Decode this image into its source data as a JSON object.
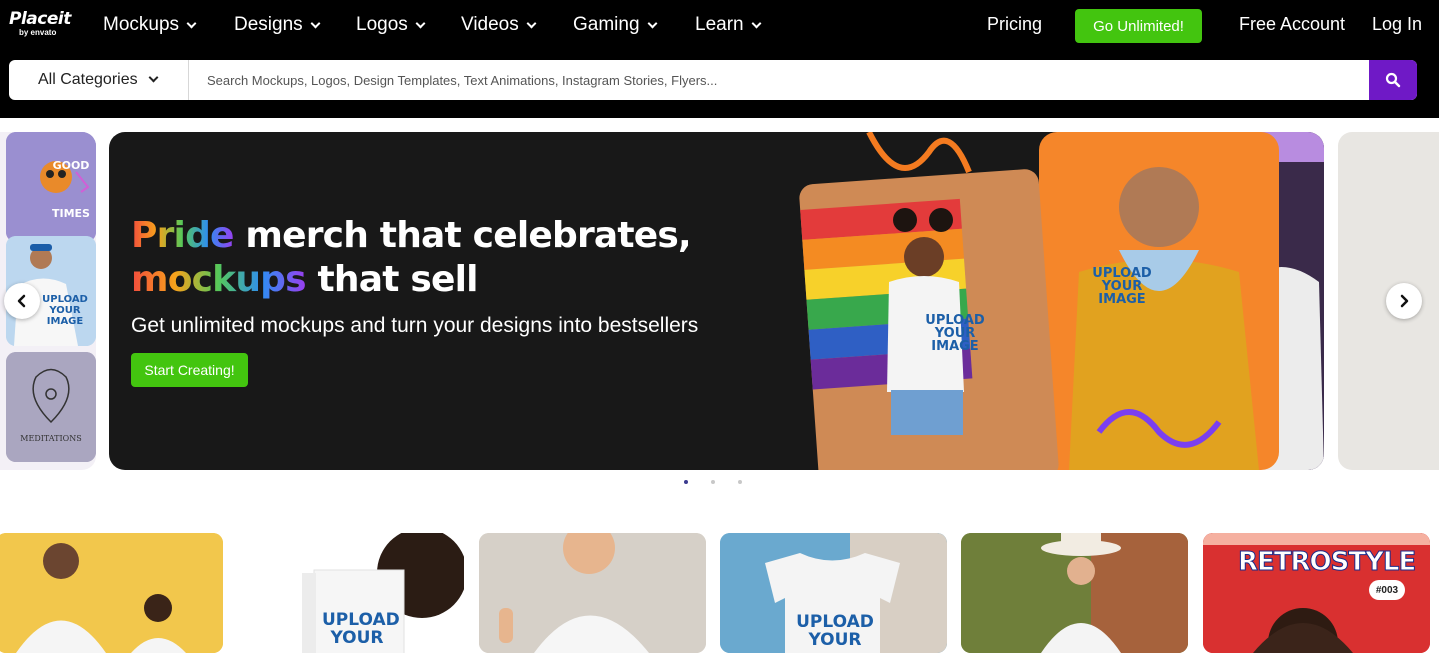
{
  "brand": {
    "name": "Placeit",
    "sub": "by envato"
  },
  "nav": {
    "items": [
      {
        "label": "Mockups"
      },
      {
        "label": "Designs"
      },
      {
        "label": "Logos"
      },
      {
        "label": "Videos"
      },
      {
        "label": "Gaming"
      },
      {
        "label": "Learn"
      }
    ],
    "pricing": "Pricing",
    "go_unlimited": "Go Unlimited!",
    "free_account": "Free Account",
    "login": "Log In"
  },
  "search": {
    "category": "All Categories",
    "placeholder": "Search Mockups, Logos, Design Templates, Text Animations, Instagram Stories, Flyers..."
  },
  "hero": {
    "headline_accent_1": "Pride",
    "headline_rest_1": " merch that celebrates,",
    "headline_accent_2": "mockups",
    "headline_rest_2": " that sell",
    "subheadline": "Get unlimited mockups and turn your designs into bestsellers",
    "cta": "Start Creating!",
    "upload_1": "UPLOAD\nYOUR\nIMAGE",
    "upload_2": "UPLOAD\nYOUR\nIMAGE",
    "upload_3": "UPLOAD\nYOUR\nIMAGE",
    "side_thumb_1": "GOOD\nTIMES",
    "side_thumb_3": "MEDITATIONS"
  },
  "carousel": {
    "slides": 3,
    "active_slide": 1
  },
  "cards": [
    {
      "text": ""
    },
    {
      "text": "UPLOAD\nYOUR"
    },
    {
      "text": ""
    },
    {
      "text": "UPLOAD\nYOUR"
    },
    {
      "text": ""
    },
    {
      "text": "RETROSTYLE",
      "badge": "#003"
    }
  ],
  "colors": {
    "accent_green": "#43c50f",
    "accent_purple": "#6f19c6",
    "nav_bg": "#000000",
    "banner_bg": "#181818"
  },
  "icons": {
    "search": "search-icon",
    "prev": "chevron-left-icon",
    "next": "chevron-right-icon"
  }
}
